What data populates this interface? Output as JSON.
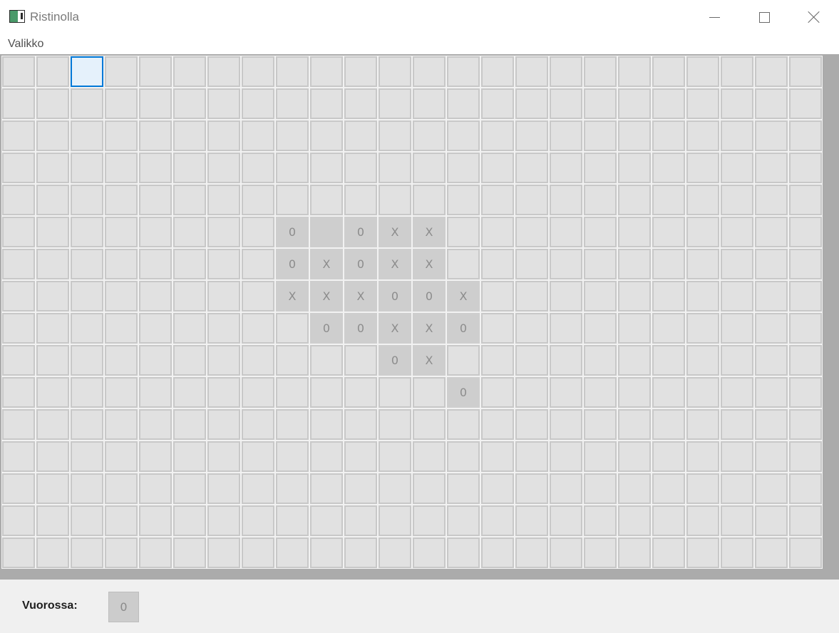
{
  "window": {
    "title": "Ristinolla",
    "controls": {
      "minimize": "minimize-icon",
      "maximize": "maximize-icon",
      "close": "close-icon"
    }
  },
  "menu": {
    "items": [
      "Valikko"
    ]
  },
  "board": {
    "columns": 24,
    "rows": 16,
    "selected": {
      "row": 0,
      "col": 2
    },
    "marks": [
      {
        "row": 5,
        "col": 8,
        "value": "0"
      },
      {
        "row": 5,
        "col": 9,
        "value": ""
      },
      {
        "row": 5,
        "col": 10,
        "value": "0"
      },
      {
        "row": 5,
        "col": 11,
        "value": "X"
      },
      {
        "row": 5,
        "col": 12,
        "value": "X"
      },
      {
        "row": 6,
        "col": 8,
        "value": "0"
      },
      {
        "row": 6,
        "col": 9,
        "value": "X"
      },
      {
        "row": 6,
        "col": 10,
        "value": "0"
      },
      {
        "row": 6,
        "col": 11,
        "value": "X"
      },
      {
        "row": 6,
        "col": 12,
        "value": "X"
      },
      {
        "row": 7,
        "col": 8,
        "value": "X"
      },
      {
        "row": 7,
        "col": 9,
        "value": "X"
      },
      {
        "row": 7,
        "col": 10,
        "value": "X"
      },
      {
        "row": 7,
        "col": 11,
        "value": "0"
      },
      {
        "row": 7,
        "col": 12,
        "value": "0"
      },
      {
        "row": 7,
        "col": 13,
        "value": "X"
      },
      {
        "row": 8,
        "col": 9,
        "value": "0"
      },
      {
        "row": 8,
        "col": 10,
        "value": "0"
      },
      {
        "row": 8,
        "col": 11,
        "value": "X"
      },
      {
        "row": 8,
        "col": 12,
        "value": "X"
      },
      {
        "row": 8,
        "col": 13,
        "value": "0"
      },
      {
        "row": 9,
        "col": 11,
        "value": "0"
      },
      {
        "row": 9,
        "col": 12,
        "value": "X"
      },
      {
        "row": 10,
        "col": 13,
        "value": "0"
      }
    ]
  },
  "status": {
    "label": "Vuorossa:",
    "turn": "0"
  },
  "colors": {
    "cell": "#e1e1e1",
    "played_cell": "#cecece",
    "selected_border": "#0078d7",
    "board_frame": "#ababab"
  }
}
